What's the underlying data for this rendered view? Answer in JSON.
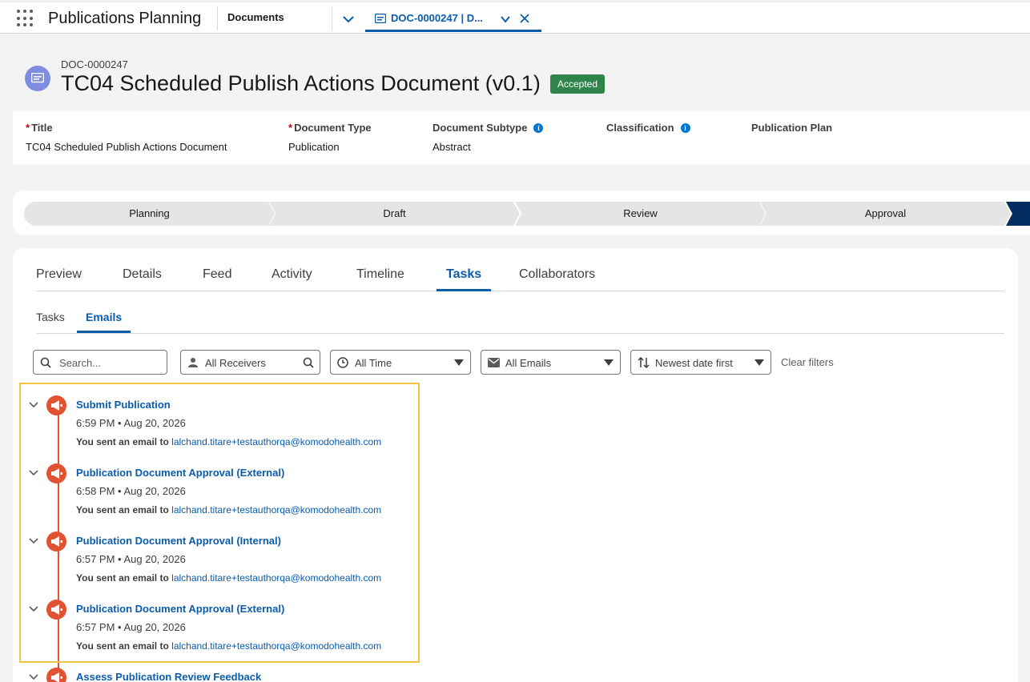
{
  "app": {
    "name": "Publications Planning"
  },
  "nav": {
    "item": "Documents",
    "tab_label": "DOC-0000247 | D..."
  },
  "record": {
    "id": "DOC-0000247",
    "title": "TC04 Scheduled Publish Actions Document (v0.1)",
    "status": "Accepted",
    "icon": "document-icon"
  },
  "fields": [
    {
      "label": "Title",
      "value": "TC04 Scheduled Publish Actions Document",
      "required": true
    },
    {
      "label": "Document Type",
      "value": "Publication",
      "required": true
    },
    {
      "label": "Document Subtype",
      "value": "Abstract",
      "info": true
    },
    {
      "label": "Classification",
      "value": "",
      "info": true
    },
    {
      "label": "Publication Plan",
      "value": ""
    }
  ],
  "path": [
    "Planning",
    "Draft",
    "Review",
    "Approval"
  ],
  "tabs": [
    "Preview",
    "Details",
    "Feed",
    "Activity",
    "Timeline",
    "Tasks",
    "Collaborators"
  ],
  "active_tab": "Tasks",
  "subtabs": [
    "Tasks",
    "Emails"
  ],
  "active_subtab": "Emails",
  "filters": {
    "search_placeholder": "Search...",
    "receivers": "All Receivers",
    "time": "All Time",
    "emails": "All Emails",
    "sort": "Newest date first",
    "clear": "Clear filters"
  },
  "timeline": [
    {
      "title": "Submit Publication",
      "time": "6:59 PM • Aug 20, 2026",
      "prefix": "You sent an email to",
      "email": "lalchand.titare+testauthorqa@komodohealth.com"
    },
    {
      "title": "Publication Document Approval (External)",
      "time": "6:58 PM • Aug 20, 2026",
      "prefix": "You sent an email to",
      "email": "lalchand.titare+testauthorqa@komodohealth.com"
    },
    {
      "title": "Publication Document Approval (Internal)",
      "time": "6:57 PM • Aug 20, 2026",
      "prefix": "You sent an email to",
      "email": "lalchand.titare+testauthorqa@komodohealth.com"
    },
    {
      "title": "Publication Document Approval (External)",
      "time": "6:57 PM • Aug 20, 2026",
      "prefix": "You sent an email to",
      "email": "lalchand.titare+testauthorqa@komodohealth.com"
    },
    {
      "title": "Assess Publication Review Feedback",
      "time": "",
      "prefix": "",
      "email": ""
    }
  ],
  "colors": {
    "brand": "#0b5cab",
    "accepted": "#2e844a",
    "email_icon": "#e15233",
    "highlight": "#f5c542"
  }
}
